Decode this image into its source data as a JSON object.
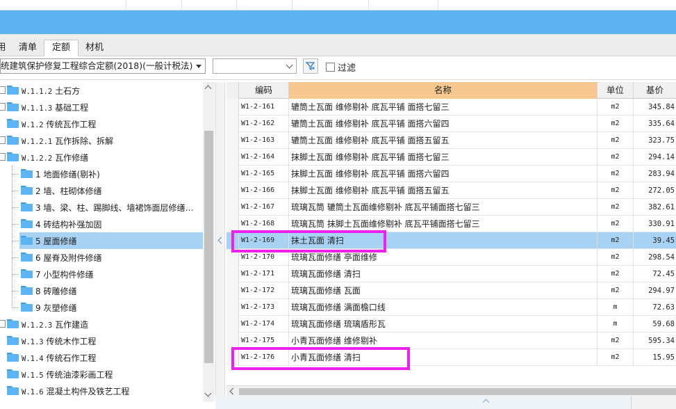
{
  "tabs": [
    {
      "label": "用",
      "active": false
    },
    {
      "label": "清单",
      "active": false
    },
    {
      "label": "定额",
      "active": true
    },
    {
      "label": "材机",
      "active": false
    }
  ],
  "toolbar": {
    "quota_library": "统建筑保护修复工程综合定额(2018)(一般计税法)",
    "secondary_select": "",
    "filter_label": "过滤",
    "filter_checked": false
  },
  "tree": [
    {
      "code": "W.1.1.2",
      "label": "土石方",
      "expandable": true
    },
    {
      "code": "W.1.1.3",
      "label": "基础工程",
      "expandable": true
    },
    {
      "code": "W.1.2",
      "label": "传统瓦作工程",
      "expandable": false
    },
    {
      "code": "W.1.2.1",
      "label": "瓦作拆除、拆解",
      "expandable": true
    },
    {
      "code": "W.1.2.2",
      "label": "瓦作修缮",
      "expandable": true
    },
    {
      "code": "",
      "label": "1 地面修缮(剔补)",
      "expandable": false
    },
    {
      "code": "",
      "label": "2 墙、柱砌体修缮",
      "expandable": false
    },
    {
      "code": "",
      "label": "3 墙、梁、柱、踢脚线、墙裙饰面层修缮…",
      "expandable": false
    },
    {
      "code": "",
      "label": "4 砖结构补强加固",
      "expandable": false
    },
    {
      "code": "",
      "label": "5 屋面修缮",
      "expandable": false,
      "selected": true
    },
    {
      "code": "",
      "label": "6 屋脊及附件修缮",
      "expandable": false
    },
    {
      "code": "",
      "label": "7 小型构件修缮",
      "expandable": false
    },
    {
      "code": "",
      "label": "8 砖雕修缮",
      "expandable": false
    },
    {
      "code": "",
      "label": "9 灰塑修缮",
      "expandable": false
    },
    {
      "code": "W.1.2.3",
      "label": "瓦作建造",
      "expandable": true
    },
    {
      "code": "W.1.3",
      "label": "传统木作工程",
      "expandable": false
    },
    {
      "code": "W.1.4",
      "label": "传统石作工程",
      "expandable": false
    },
    {
      "code": "W.1.5",
      "label": "传统油漆彩画工程",
      "expandable": false
    },
    {
      "code": "W.1.6",
      "label": "混凝土构件及铁艺工程",
      "expandable": false
    }
  ],
  "grid": {
    "columns": {
      "code": "编码",
      "name": "名称",
      "unit": "单位",
      "price": "基价"
    },
    "rows": [
      {
        "code": "W1-2-161",
        "name": "辘筒土瓦面 维修剔补 底瓦平铺 面搭七留三",
        "unit": "m2",
        "price": "345.84"
      },
      {
        "code": "W1-2-162",
        "name": "辘筒土瓦面 维修剔补 底瓦平铺 面搭六留四",
        "unit": "m2",
        "price": "335.64"
      },
      {
        "code": "W1-2-163",
        "name": "辘筒土瓦面 维修剔补 底瓦平铺 面搭五留五",
        "unit": "m2",
        "price": "323.75"
      },
      {
        "code": "W1-2-164",
        "name": "抹脚土瓦面 维修剔补 底瓦平铺 面搭七留三",
        "unit": "m2",
        "price": "294.14"
      },
      {
        "code": "W1-2-165",
        "name": "抹脚土瓦面 维修剔补 底瓦平铺 面搭六留四",
        "unit": "m2",
        "price": "283.94"
      },
      {
        "code": "W1-2-166",
        "name": "抹脚土瓦面 维修剔补 底瓦平铺 面搭五留五",
        "unit": "m2",
        "price": "272.05"
      },
      {
        "code": "W1-2-167",
        "name": "琉璃瓦筒 辘筒土瓦面维修剔补 底瓦平铺面搭七留三",
        "unit": "m2",
        "price": "382.61"
      },
      {
        "code": "W1-2-168",
        "name": "琉璃瓦筒 抹脚土瓦面维修剔补 底瓦平铺面搭七留三",
        "unit": "m2",
        "price": "330.91"
      },
      {
        "code": "W1-2-169",
        "name": "抹土瓦面 清扫",
        "unit": "m2",
        "price": "39.45",
        "selected": true
      },
      {
        "code": "W1-2-170",
        "name": "琉璃瓦面修缮 亭面维修",
        "unit": "m2",
        "price": "298.54"
      },
      {
        "code": "W1-2-171",
        "name": "琉璃瓦面修缮 清扫",
        "unit": "m2",
        "price": "72.45"
      },
      {
        "code": "W1-2-172",
        "name": "琉璃瓦面修缮 瓦面",
        "unit": "m2",
        "price": "294.97"
      },
      {
        "code": "W1-2-173",
        "name": "琉璃瓦面修缮 满面檐口线",
        "unit": "m",
        "price": "72.63"
      },
      {
        "code": "W1-2-174",
        "name": "琉璃瓦面修缮 琉璃盾形瓦",
        "unit": "m",
        "price": "59.68"
      },
      {
        "code": "W1-2-175",
        "name": "小青瓦面修缮 维修剔补",
        "unit": "m2",
        "price": "595.34"
      },
      {
        "code": "W1-2-176",
        "name": "小青瓦面修缮 清扫",
        "unit": "m2",
        "price": "15.95"
      }
    ]
  },
  "colors": {
    "title_band": "#5fb2f1",
    "selected_row": "#a8d2f4",
    "name_header": "#f6c88f",
    "annotation": "#ee22ee",
    "folder": "#5db4f3"
  }
}
